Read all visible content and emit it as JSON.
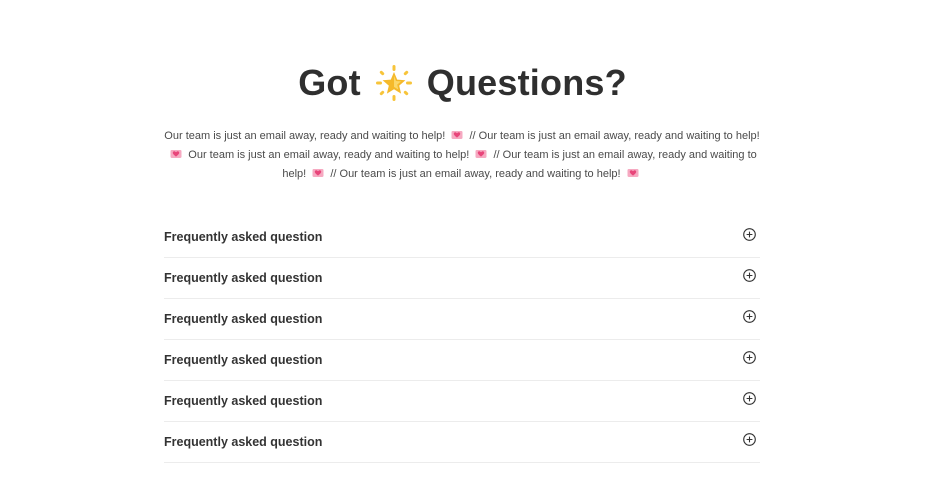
{
  "heading": {
    "word1": "Got",
    "word2": "Questions?",
    "icon": "sparkle-star-icon"
  },
  "intro": {
    "segments": [
      "Our team is just an email away, ready and waiting to help!",
      "// Our team is just an email away, ready and waiting to help!",
      "Our team is just an email away, ready and waiting to help!",
      "// Our team is just an email away, ready and waiting to help!",
      "// Our team is just an email away, ready and waiting to help!"
    ],
    "icon": "love-letter-icon"
  },
  "faq": {
    "items": [
      {
        "question": "Frequently asked question",
        "icon": "plus-circle-icon"
      },
      {
        "question": "Frequently asked question",
        "icon": "plus-circle-icon"
      },
      {
        "question": "Frequently asked question",
        "icon": "plus-circle-icon"
      },
      {
        "question": "Frequently asked question",
        "icon": "plus-circle-icon"
      },
      {
        "question": "Frequently asked question",
        "icon": "plus-circle-icon"
      },
      {
        "question": "Frequently asked question",
        "icon": "plus-circle-icon"
      }
    ]
  },
  "colors": {
    "text": "#333333",
    "star": "#f7c43a",
    "heart": "#e8457a",
    "divider": "#ececec"
  }
}
